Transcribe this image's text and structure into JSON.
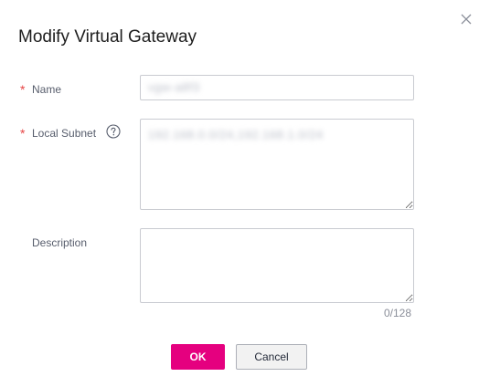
{
  "dialog": {
    "title": "Modify Virtual Gateway",
    "close_symbol": "×"
  },
  "form": {
    "name": {
      "required_mark": "*",
      "label": "Name",
      "value": "vgw-a8f3"
    },
    "local_subnet": {
      "required_mark": "*",
      "label": "Local Subnet",
      "help_icon": "question-circle-icon",
      "value": "192.168.0.0/24,192.168.1.0/24"
    },
    "description": {
      "label": "Description",
      "value": "",
      "counter": "0/128"
    }
  },
  "buttons": {
    "ok_label": "OK",
    "cancel_label": "Cancel"
  },
  "colors": {
    "primary": "#e5007f",
    "required": "#e64545",
    "border": "#c9cbd1"
  }
}
